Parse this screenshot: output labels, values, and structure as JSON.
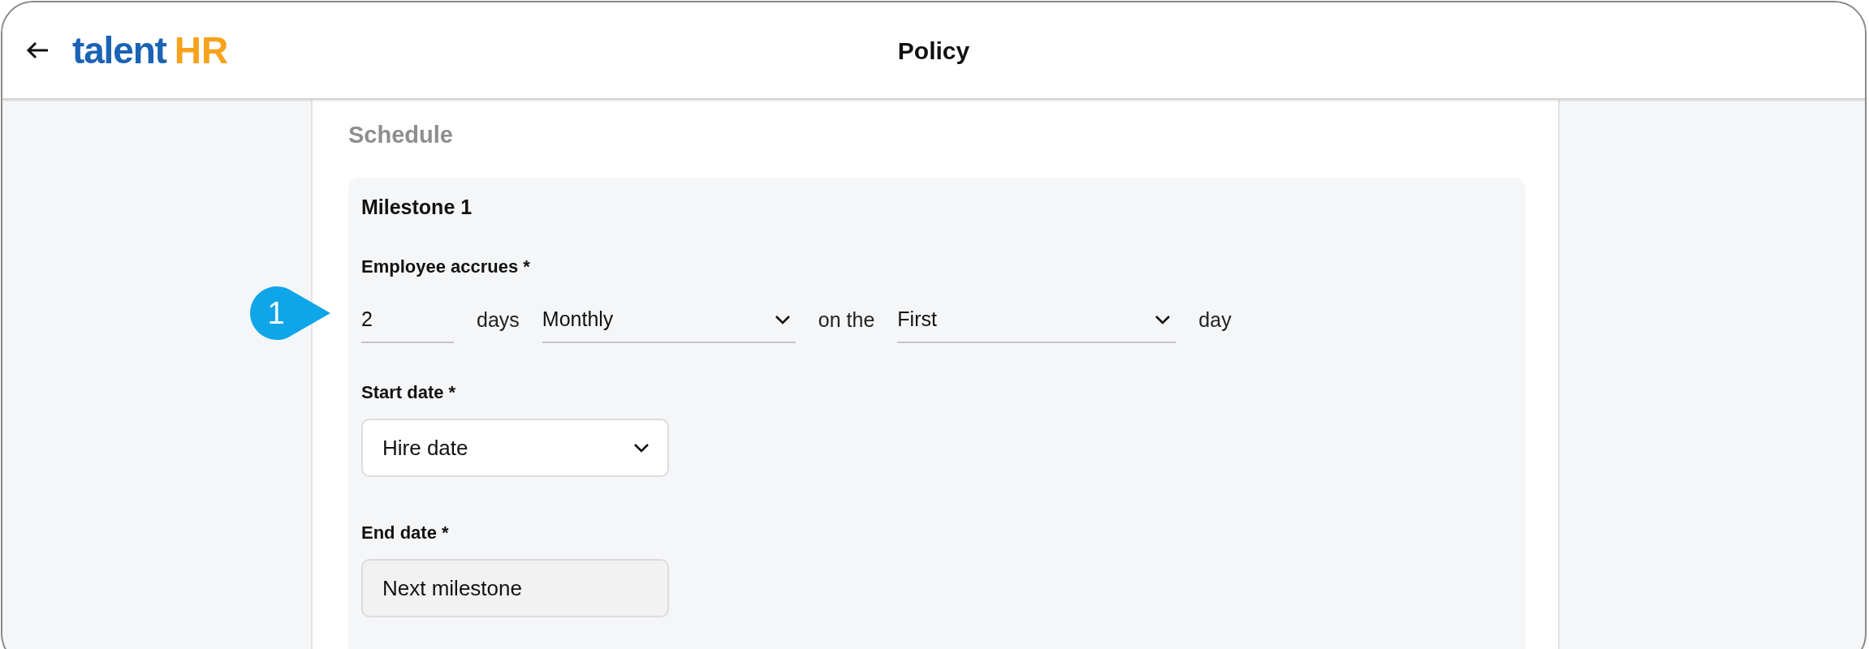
{
  "header": {
    "logo": {
      "part_1": "talent",
      "part_2": "HR"
    },
    "title": "Policy"
  },
  "section": {
    "title": "Schedule"
  },
  "milestone": {
    "title": "Milestone 1",
    "accrual": {
      "label": "Employee accrues *",
      "callout": "1",
      "items": [
        {
          "kind": "input",
          "value": "2"
        },
        {
          "kind": "text",
          "text": "days"
        },
        {
          "kind": "select",
          "value": "Monthly"
        },
        {
          "kind": "text",
          "text": "on the"
        },
        {
          "kind": "select",
          "value": "First"
        },
        {
          "kind": "text",
          "text": "day"
        }
      ]
    },
    "fields": [
      {
        "label": "Start date *",
        "kind": "select",
        "value": "Hire date",
        "disabled": false
      },
      {
        "label": "End date *",
        "kind": "input",
        "value": "Next milestone",
        "disabled": true
      }
    ]
  }
}
